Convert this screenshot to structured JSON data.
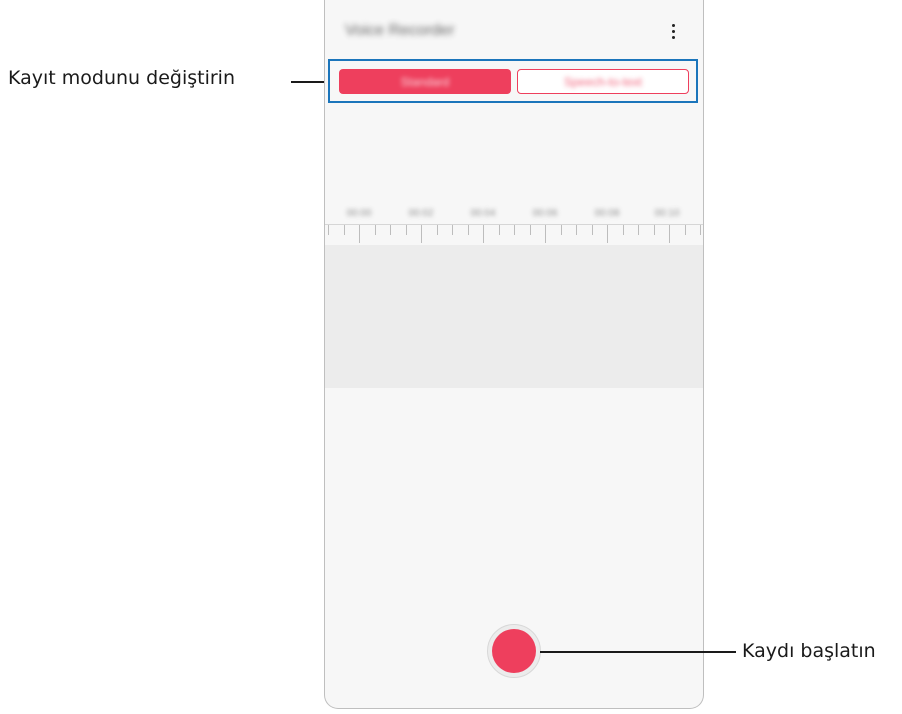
{
  "app": {
    "title": "Voice Recorder"
  },
  "header": {
    "more_icon": "more-vertical-icon"
  },
  "modes": {
    "standard_label": "Standard",
    "stt_label": "Speech-to-text",
    "active": "Standard"
  },
  "timeline": {
    "labels": [
      "00:00",
      "00:02",
      "00:04",
      "00:06",
      "00:08",
      "00:10"
    ]
  },
  "record": {
    "icon": "record-icon"
  },
  "callouts": {
    "mode": "Kayıt modunu değiştirin",
    "record": "Kaydı başlatın"
  },
  "colors": {
    "accent": "#ee3f5d",
    "highlight": "#1b75bb",
    "screen_bg": "#f7f7f7",
    "wave_bg": "#ececec"
  }
}
